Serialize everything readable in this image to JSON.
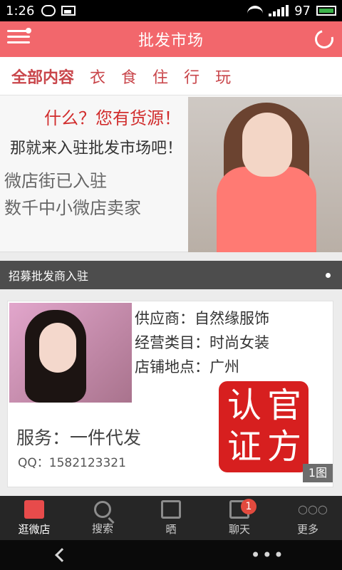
{
  "status_bar": {
    "time": "1:26",
    "battery": "97"
  },
  "header": {
    "title": "批发市场"
  },
  "tabs": [
    "全部内容",
    "衣",
    "食",
    "住",
    "行",
    "玩"
  ],
  "banner": {
    "headline": "什么？您有货源！",
    "line2": "那就来入驻批发市场吧！",
    "line3": "微店街已入驻",
    "line4": "数千中小微店卖家"
  },
  "section": {
    "title": "招募批发商入驻"
  },
  "card": {
    "supplier": "供应商：自然缘服饰",
    "category": "经营类目：时尚女装",
    "location": "店铺地点：广州",
    "service": "服务：一件代发",
    "qq": "QQ：1582123321",
    "stamp_chars": [
      "认",
      "官",
      "证",
      "方"
    ],
    "image_count": "1图"
  },
  "bottom_nav": {
    "items": [
      {
        "label": "逛微店"
      },
      {
        "label": "搜索"
      },
      {
        "label": "晒"
      },
      {
        "label": "聊天",
        "badge": "1"
      },
      {
        "label": "更多"
      }
    ]
  },
  "system_nav": {
    "more_dots": "•••"
  }
}
